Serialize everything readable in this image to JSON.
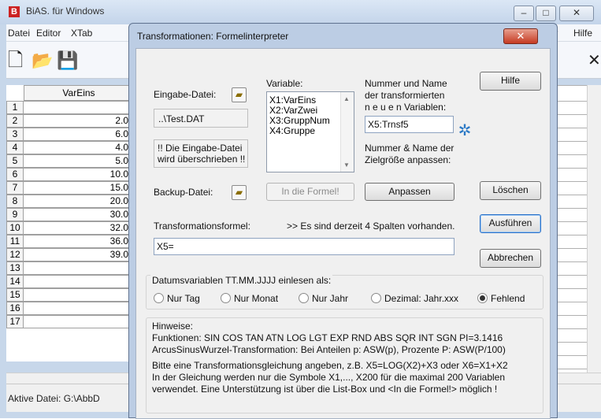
{
  "main_window": {
    "title": "BiAS. für Windows",
    "menu": [
      "Datei",
      "Editor",
      "XTab"
    ],
    "menu_right": "Hilfe",
    "menu_right_prefix": "?",
    "minimize": "–",
    "maximize": "□",
    "close": "✕",
    "grid": {
      "column_header": "VarEins",
      "rows": [
        {
          "n": "1",
          "v": ""
        },
        {
          "n": "2",
          "v": "2.0"
        },
        {
          "n": "3",
          "v": "6.0"
        },
        {
          "n": "4",
          "v": "4.0"
        },
        {
          "n": "5",
          "v": "5.0"
        },
        {
          "n": "6",
          "v": "10.0"
        },
        {
          "n": "7",
          "v": "15.0"
        },
        {
          "n": "8",
          "v": "20.0"
        },
        {
          "n": "9",
          "v": "30.0"
        },
        {
          "n": "10",
          "v": "32.0"
        },
        {
          "n": "11",
          "v": "36.0"
        },
        {
          "n": "12",
          "v": "39.0"
        },
        {
          "n": "13",
          "v": ""
        },
        {
          "n": "14",
          "v": ""
        },
        {
          "n": "15",
          "v": ""
        },
        {
          "n": "16",
          "v": ""
        },
        {
          "n": "17",
          "v": ""
        }
      ]
    },
    "status": "Aktive Datei: G:\\AbbD",
    "toolbar_close": "✕"
  },
  "dialog": {
    "title": "Transformationen: Formelinterpreter",
    "close": "✕",
    "eingabe_label": "Eingabe-Datei:",
    "eingabe_file": "..\\Test.DAT",
    "warning_line1": "!! Die Eingabe-Datei",
    "warning_line2": "wird überschrieben !!",
    "backup_label": "Backup-Datei:",
    "variable_label": "Variable:",
    "variables": [
      "X1:VarEins",
      "X2:VarZwei",
      "X3:GruppNum",
      "X4:Gruppe"
    ],
    "in_formel": "In die Formel!",
    "nummer_label_1": "Nummer und Name",
    "nummer_label_2": "der transformierten",
    "nummer_label_3": "n e u e n  Variablen:",
    "new_var": "X5:Trnsf5",
    "ziel_label_1": "Nummer & Name der",
    "ziel_label_2": "Zielgröße anpassen:",
    "anpassen": "Anpassen",
    "hilfe": "Hilfe",
    "loeschen": "Löschen",
    "ausfuehren": "Ausführen",
    "abbrechen": "Abbrechen",
    "formel_label": "Transformationsformel:",
    "spalten_info": ">> Es sind derzeit 4 Spalten vorhanden.",
    "formel_value": "X5=",
    "datum_label": "Datumsvariablen TT.MM.JJJJ einlesen als:",
    "radios": [
      {
        "label": "Nur Tag",
        "checked": false
      },
      {
        "label": "Nur Monat",
        "checked": false
      },
      {
        "label": "Nur Jahr",
        "checked": false
      },
      {
        "label": "Dezimal: Jahr.xxx",
        "checked": false
      },
      {
        "label": "Fehlend",
        "checked": true
      }
    ],
    "hinweise_title": "Hinweise:",
    "hinweise": [
      "Funktionen: SIN COS TAN ATN LOG LGT EXP RND ABS SQR INT SGN PI=3.1416",
      "ArcusSinusWurzel-Transformation:  Bei Anteilen p: ASW(p), Prozente P: ASW(P/100)",
      "Bitte eine Transformationsgleichung angeben, z.B.  X5=LOG(X2)+X3 oder X6=X1+X2",
      "In der Gleichung werden nur die Symbole  X1,..., X200 für die maximal 200  Variablen",
      "verwendet.  Eine  Unterstützung ist über die List-Box  und  <In die Formel!>  möglich !"
    ]
  }
}
